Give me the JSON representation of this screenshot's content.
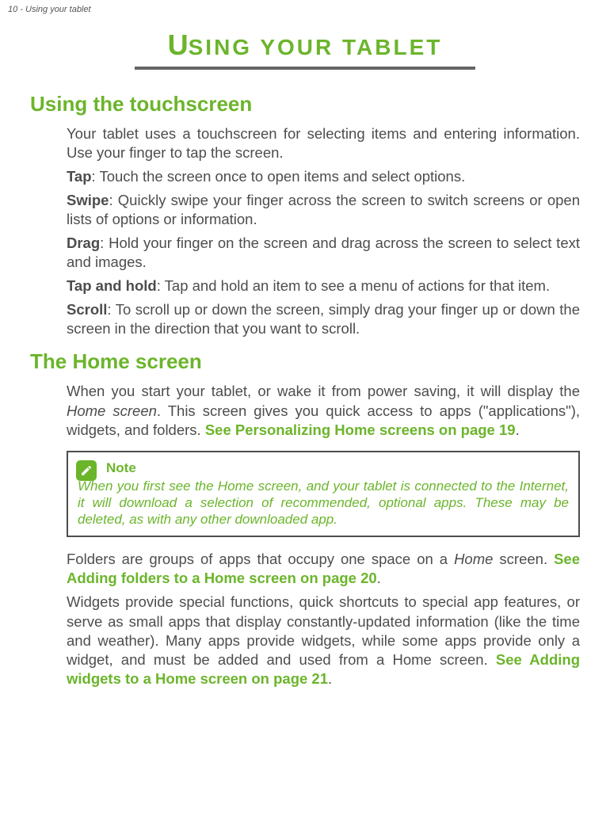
{
  "header": {
    "running": "10 - Using your tablet"
  },
  "chapter": {
    "title_first": "U",
    "title_rest": "SING YOUR TABLET"
  },
  "section1": {
    "heading": "Using the touchscreen",
    "intro": "Your tablet uses a touchscreen for selecting items and entering information. Use your finger to tap the screen.",
    "tap_label": "Tap",
    "tap_text": ": Touch the screen once to open items and select options.",
    "swipe_label": "Swipe",
    "swipe_text": ": Quickly swipe your finger across the screen to switch screens or open lists of options or information.",
    "drag_label": "Drag",
    "drag_text": ": Hold your finger on the screen and drag across the screen to select text and images.",
    "taphold_label": "Tap and hold",
    "taphold_text": ": Tap and hold an item to see a menu of actions for that item.",
    "scroll_label": "Scroll",
    "scroll_text": ": To scroll up or down the screen, simply drag your finger up or down the screen in the direction that you want to scroll."
  },
  "section2": {
    "heading": "The Home screen",
    "p1_a": "When you start your tablet, or wake it from power saving, it will display the ",
    "p1_home": "Home screen",
    "p1_b": ". This screen gives you quick access to apps (\"applications\"), widgets, and folders. ",
    "p1_link": "See Personalizing Home screens on page 19",
    "p1_c": ".",
    "note_label": "Note",
    "note_text": "When you first see the Home screen, and your tablet is connected to the Internet, it will download a selection of recommended, optional apps. These may be deleted, as with any other downloaded app.",
    "p2_a": "Folders are groups of apps that occupy one space on a ",
    "p2_home": "Home",
    "p2_b": " screen. ",
    "p2_link": "See Adding folders to a Home screen on page 20",
    "p2_c": ".",
    "p3_a": "Widgets provide special functions, quick shortcuts to special app features, or serve as small apps that display constantly-updated information (like the time and weather). Many apps provide widgets, while some apps provide only a widget, and must be added and used from a Home screen. ",
    "p3_link": "See Adding widgets to a Home screen on page 21",
    "p3_b": "."
  }
}
